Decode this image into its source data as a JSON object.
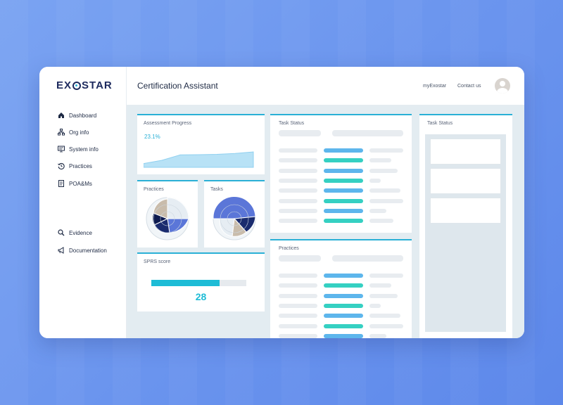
{
  "brand": {
    "logo_pre": "EX",
    "logo_post": "STAR"
  },
  "sidebar": {
    "items": [
      {
        "label": "Dashboard",
        "icon": "home-icon"
      },
      {
        "label": "Org info",
        "icon": "org-chart-icon"
      },
      {
        "label": "System info",
        "icon": "monitor-icon"
      },
      {
        "label": "Practices",
        "icon": "history-icon"
      },
      {
        "label": "POA&Ms",
        "icon": "document-icon"
      },
      {
        "label": "Evidence",
        "icon": "search-icon"
      },
      {
        "label": "Documentation",
        "icon": "megaphone-icon"
      }
    ]
  },
  "header": {
    "title": "Certification Assistant",
    "links": [
      "myExostar",
      "Contact us"
    ]
  },
  "cards": {
    "assessment": {
      "title": "Assessment Progress",
      "value": "23.1%",
      "series": [
        12,
        28,
        55,
        56,
        58,
        62,
        70
      ]
    },
    "practices_small": {
      "title": "Practices"
    },
    "tasks_small": {
      "title": "Tasks"
    },
    "sprs": {
      "title": "SPRS score",
      "value": "28",
      "progress": 0.72
    },
    "task_status": {
      "title": "Task Status"
    },
    "practices_list": {
      "title": "Practices"
    },
    "task_status_right": {
      "title": "Task Status"
    }
  },
  "colors": {
    "accent": "#2ab0d6",
    "teal": "#35d0c2",
    "blue": "#5db6ec",
    "navy": "#1d2a5e"
  }
}
